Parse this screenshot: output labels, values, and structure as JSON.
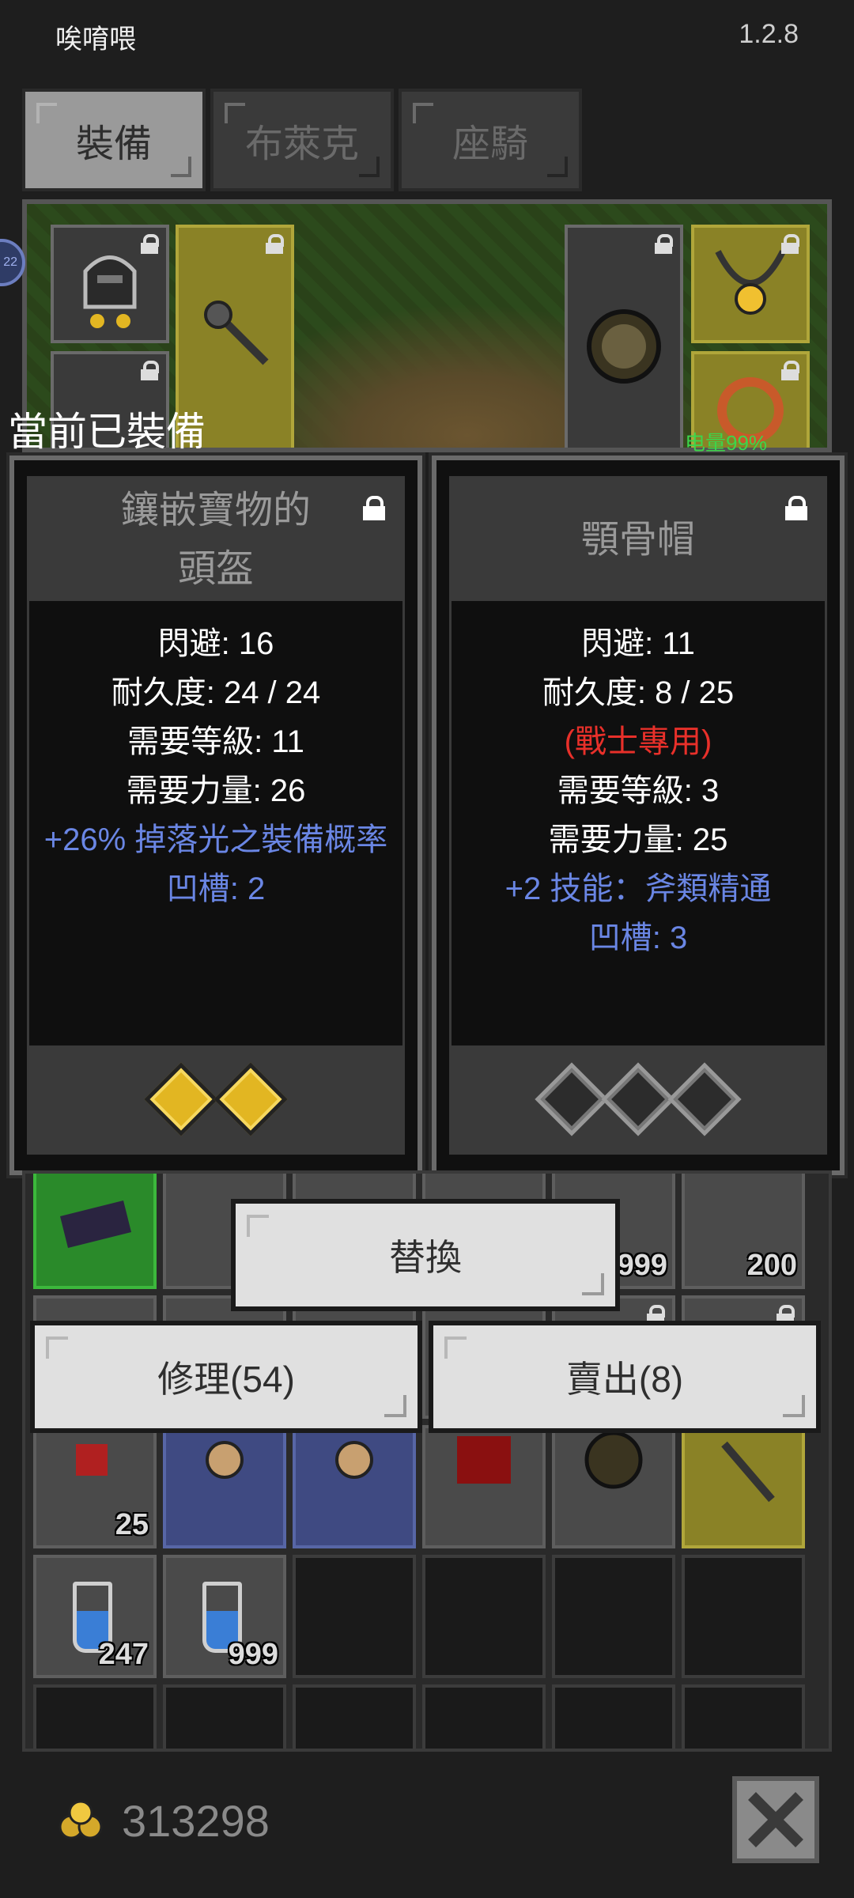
{
  "status": {
    "left_text": "唉唷喂",
    "version": "1.2.8"
  },
  "tabs": [
    {
      "label": "裝備",
      "active": true
    },
    {
      "label": "布萊克",
      "active": false
    },
    {
      "label": "座騎",
      "active": false
    }
  ],
  "side_badge": "22",
  "scene": {
    "battery": "电量99%"
  },
  "equipped_label": "當前已裝備",
  "card_left": {
    "title_line1": "鑲嵌寶物的",
    "title_line2": "頭盔",
    "stats": [
      "閃避: 16",
      "耐久度: 24 / 24",
      "需要等級: 11",
      "需要力量: 26"
    ],
    "bonus": "+26% 掉落光之裝備概率",
    "sockets": "凹槽: 2"
  },
  "card_right": {
    "title": "顎骨帽",
    "stats_a": [
      "閃避: 11",
      "耐久度: 8 / 25"
    ],
    "class_req": "(戰士專用)",
    "stats_b": [
      "需要等級: 3",
      "需要力量: 25"
    ],
    "bonus": "+2 技能：斧類精通",
    "sockets": "凹槽: 3"
  },
  "inventory": {
    "qty": [
      "999",
      "200",
      "25",
      "247",
      "999"
    ]
  },
  "buttons": {
    "replace": "替換",
    "repair": "修理(54)",
    "sell": "賣出(8)"
  },
  "gold": "313298",
  "colors": {
    "accent_blue": "#6a86e4",
    "warn_red": "#e8302a",
    "battery_green": "#3cd64b"
  }
}
